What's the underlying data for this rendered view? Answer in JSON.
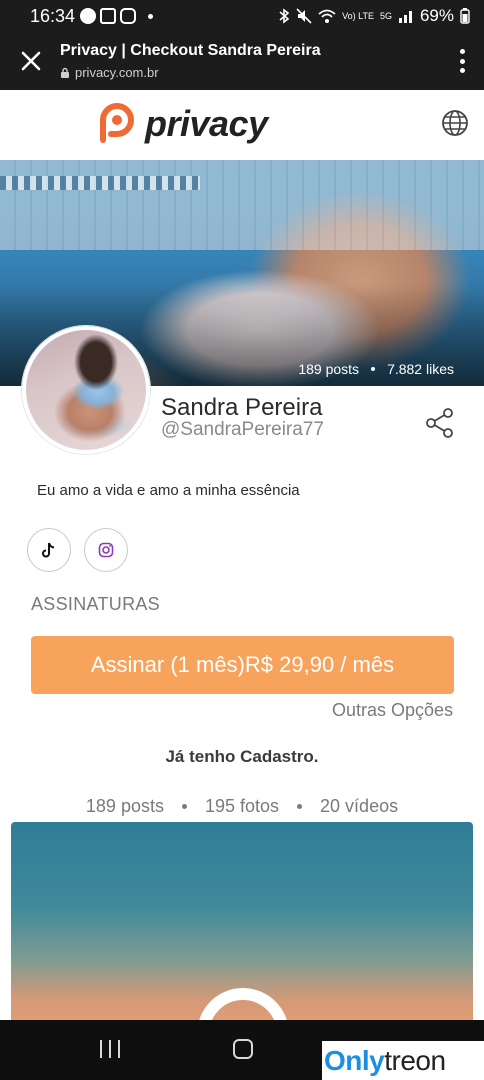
{
  "status_bar": {
    "time": "16:34",
    "network": "5G",
    "volte": "Vo) LTE",
    "battery": "69%"
  },
  "browser": {
    "title": "Privacy | Checkout Sandra Pereira",
    "url": "privacy.com.br"
  },
  "site": {
    "logo_text": "privacy",
    "brand_color": "#f06a35"
  },
  "banner": {
    "posts": "189 posts",
    "likes": "7.882 likes"
  },
  "profile": {
    "name": "Sandra Pereira",
    "handle": "@SandraPereira77",
    "bio": "Eu amo a vida e amo a minha essência"
  },
  "social": {
    "tiktok_icon": "tiktok-icon",
    "instagram_icon": "instagram-icon"
  },
  "subscriptions": {
    "label": "ASSINATURAS",
    "button_label": "Assinar (1 mês)R$ 29,90 / mês",
    "button_color": "#f7a35c",
    "other_options": "Outras Opções"
  },
  "login": {
    "label": "Já tenho Cadastro."
  },
  "counts": {
    "posts": "189 posts",
    "photos": "195 fotos",
    "videos": "20 vídeos"
  },
  "watermark": {
    "part1": "Only",
    "part2": "treon"
  }
}
